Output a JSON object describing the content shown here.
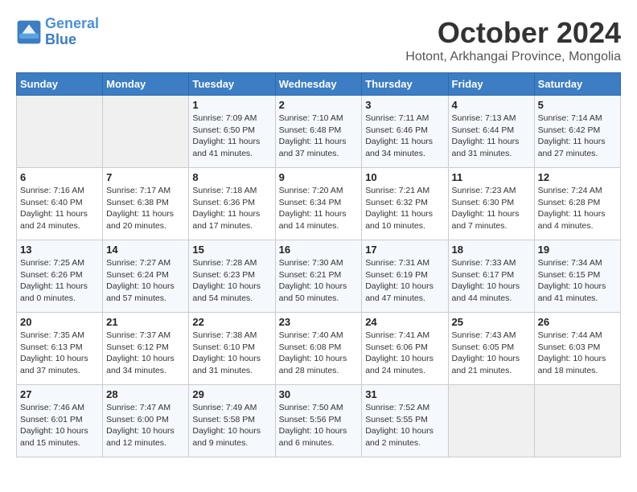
{
  "header": {
    "logo_line1": "General",
    "logo_line2": "Blue",
    "month": "October 2024",
    "location": "Hotont, Arkhangai Province, Mongolia"
  },
  "weekdays": [
    "Sunday",
    "Monday",
    "Tuesday",
    "Wednesday",
    "Thursday",
    "Friday",
    "Saturday"
  ],
  "weeks": [
    [
      {
        "day": "",
        "sunrise": "",
        "sunset": "",
        "daylight": ""
      },
      {
        "day": "",
        "sunrise": "",
        "sunset": "",
        "daylight": ""
      },
      {
        "day": "1",
        "sunrise": "Sunrise: 7:09 AM",
        "sunset": "Sunset: 6:50 PM",
        "daylight": "Daylight: 11 hours and 41 minutes."
      },
      {
        "day": "2",
        "sunrise": "Sunrise: 7:10 AM",
        "sunset": "Sunset: 6:48 PM",
        "daylight": "Daylight: 11 hours and 37 minutes."
      },
      {
        "day": "3",
        "sunrise": "Sunrise: 7:11 AM",
        "sunset": "Sunset: 6:46 PM",
        "daylight": "Daylight: 11 hours and 34 minutes."
      },
      {
        "day": "4",
        "sunrise": "Sunrise: 7:13 AM",
        "sunset": "Sunset: 6:44 PM",
        "daylight": "Daylight: 11 hours and 31 minutes."
      },
      {
        "day": "5",
        "sunrise": "Sunrise: 7:14 AM",
        "sunset": "Sunset: 6:42 PM",
        "daylight": "Daylight: 11 hours and 27 minutes."
      }
    ],
    [
      {
        "day": "6",
        "sunrise": "Sunrise: 7:16 AM",
        "sunset": "Sunset: 6:40 PM",
        "daylight": "Daylight: 11 hours and 24 minutes."
      },
      {
        "day": "7",
        "sunrise": "Sunrise: 7:17 AM",
        "sunset": "Sunset: 6:38 PM",
        "daylight": "Daylight: 11 hours and 20 minutes."
      },
      {
        "day": "8",
        "sunrise": "Sunrise: 7:18 AM",
        "sunset": "Sunset: 6:36 PM",
        "daylight": "Daylight: 11 hours and 17 minutes."
      },
      {
        "day": "9",
        "sunrise": "Sunrise: 7:20 AM",
        "sunset": "Sunset: 6:34 PM",
        "daylight": "Daylight: 11 hours and 14 minutes."
      },
      {
        "day": "10",
        "sunrise": "Sunrise: 7:21 AM",
        "sunset": "Sunset: 6:32 PM",
        "daylight": "Daylight: 11 hours and 10 minutes."
      },
      {
        "day": "11",
        "sunrise": "Sunrise: 7:23 AM",
        "sunset": "Sunset: 6:30 PM",
        "daylight": "Daylight: 11 hours and 7 minutes."
      },
      {
        "day": "12",
        "sunrise": "Sunrise: 7:24 AM",
        "sunset": "Sunset: 6:28 PM",
        "daylight": "Daylight: 11 hours and 4 minutes."
      }
    ],
    [
      {
        "day": "13",
        "sunrise": "Sunrise: 7:25 AM",
        "sunset": "Sunset: 6:26 PM",
        "daylight": "Daylight: 11 hours and 0 minutes."
      },
      {
        "day": "14",
        "sunrise": "Sunrise: 7:27 AM",
        "sunset": "Sunset: 6:24 PM",
        "daylight": "Daylight: 10 hours and 57 minutes."
      },
      {
        "day": "15",
        "sunrise": "Sunrise: 7:28 AM",
        "sunset": "Sunset: 6:23 PM",
        "daylight": "Daylight: 10 hours and 54 minutes."
      },
      {
        "day": "16",
        "sunrise": "Sunrise: 7:30 AM",
        "sunset": "Sunset: 6:21 PM",
        "daylight": "Daylight: 10 hours and 50 minutes."
      },
      {
        "day": "17",
        "sunrise": "Sunrise: 7:31 AM",
        "sunset": "Sunset: 6:19 PM",
        "daylight": "Daylight: 10 hours and 47 minutes."
      },
      {
        "day": "18",
        "sunrise": "Sunrise: 7:33 AM",
        "sunset": "Sunset: 6:17 PM",
        "daylight": "Daylight: 10 hours and 44 minutes."
      },
      {
        "day": "19",
        "sunrise": "Sunrise: 7:34 AM",
        "sunset": "Sunset: 6:15 PM",
        "daylight": "Daylight: 10 hours and 41 minutes."
      }
    ],
    [
      {
        "day": "20",
        "sunrise": "Sunrise: 7:35 AM",
        "sunset": "Sunset: 6:13 PM",
        "daylight": "Daylight: 10 hours and 37 minutes."
      },
      {
        "day": "21",
        "sunrise": "Sunrise: 7:37 AM",
        "sunset": "Sunset: 6:12 PM",
        "daylight": "Daylight: 10 hours and 34 minutes."
      },
      {
        "day": "22",
        "sunrise": "Sunrise: 7:38 AM",
        "sunset": "Sunset: 6:10 PM",
        "daylight": "Daylight: 10 hours and 31 minutes."
      },
      {
        "day": "23",
        "sunrise": "Sunrise: 7:40 AM",
        "sunset": "Sunset: 6:08 PM",
        "daylight": "Daylight: 10 hours and 28 minutes."
      },
      {
        "day": "24",
        "sunrise": "Sunrise: 7:41 AM",
        "sunset": "Sunset: 6:06 PM",
        "daylight": "Daylight: 10 hours and 24 minutes."
      },
      {
        "day": "25",
        "sunrise": "Sunrise: 7:43 AM",
        "sunset": "Sunset: 6:05 PM",
        "daylight": "Daylight: 10 hours and 21 minutes."
      },
      {
        "day": "26",
        "sunrise": "Sunrise: 7:44 AM",
        "sunset": "Sunset: 6:03 PM",
        "daylight": "Daylight: 10 hours and 18 minutes."
      }
    ],
    [
      {
        "day": "27",
        "sunrise": "Sunrise: 7:46 AM",
        "sunset": "Sunset: 6:01 PM",
        "daylight": "Daylight: 10 hours and 15 minutes."
      },
      {
        "day": "28",
        "sunrise": "Sunrise: 7:47 AM",
        "sunset": "Sunset: 6:00 PM",
        "daylight": "Daylight: 10 hours and 12 minutes."
      },
      {
        "day": "29",
        "sunrise": "Sunrise: 7:49 AM",
        "sunset": "Sunset: 5:58 PM",
        "daylight": "Daylight: 10 hours and 9 minutes."
      },
      {
        "day": "30",
        "sunrise": "Sunrise: 7:50 AM",
        "sunset": "Sunset: 5:56 PM",
        "daylight": "Daylight: 10 hours and 6 minutes."
      },
      {
        "day": "31",
        "sunrise": "Sunrise: 7:52 AM",
        "sunset": "Sunset: 5:55 PM",
        "daylight": "Daylight: 10 hours and 2 minutes."
      },
      {
        "day": "",
        "sunrise": "",
        "sunset": "",
        "daylight": ""
      },
      {
        "day": "",
        "sunrise": "",
        "sunset": "",
        "daylight": ""
      }
    ]
  ]
}
